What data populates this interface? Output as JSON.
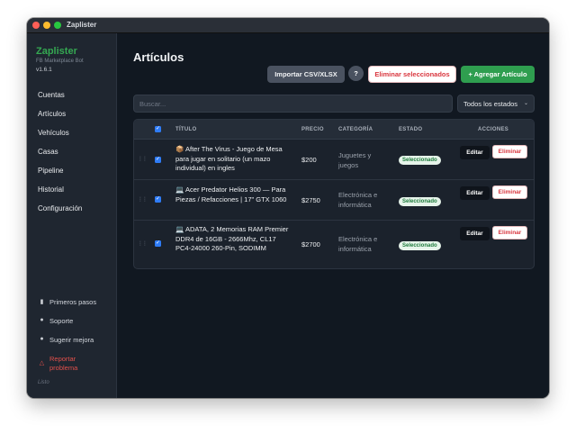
{
  "window": {
    "title": "Zaplister"
  },
  "sidebar": {
    "brand": {
      "name": "Zaplister",
      "subtitle": "FB Marketplace Bot",
      "version": "v1.6.1"
    },
    "nav": [
      "Cuentas",
      "Artículos",
      "Vehículos",
      "Casas",
      "Pipeline",
      "Historial",
      "Configuración"
    ],
    "bottom": [
      {
        "label": "Primeros pasos",
        "icon": "book-icon"
      },
      {
        "label": "Soporte",
        "icon": "chat-bubble-icon"
      },
      {
        "label": "Sugerir mejora",
        "icon": "lightbulb-icon"
      },
      {
        "label": "Reportar problema",
        "icon": "warning-triangle-icon"
      }
    ],
    "status": "Listo"
  },
  "main": {
    "title": "Artículos",
    "buttons": {
      "import": "Importar CSV/XLSX",
      "help": "?",
      "delete_selected": "Eliminar seleccionados",
      "add": "+ Agregar Artículo"
    },
    "search": {
      "placeholder": "Buscar...",
      "value": ""
    },
    "filter": {
      "selected": "Todos los estados"
    },
    "table": {
      "headers": [
        "TÍTULO",
        "PRECIO",
        "CATEGORÍA",
        "ESTADO",
        "ACCIONES"
      ],
      "rows": [
        {
          "icon": "📦",
          "title": "After The Virus - Juego de Mesa para jugar en solitario (un mazo individual) en ingles",
          "price": "$200",
          "category": "Juguetes y juegos",
          "status": "Seleccionado",
          "edit": "Editar",
          "delete": "Eliminar",
          "checked": true
        },
        {
          "icon": "💻",
          "title": "Acer Predator Helios 300 — Para Piezas / Refacciones | 17\" GTX 1060",
          "price": "$2750",
          "category": "Electrónica e informática",
          "status": "Seleccionado",
          "edit": "Editar",
          "delete": "Eliminar",
          "checked": true
        },
        {
          "icon": "💻",
          "title": "ADATA, 2 Memorias RAM Premier DDR4 de 16GB - 2666Mhz, CL17 PC4-24000 260-Pin, SODIMM",
          "price": "$2700",
          "category": "Electrónica e informática",
          "status": "Seleccionado",
          "edit": "Editar",
          "delete": "Eliminar",
          "checked": true
        }
      ]
    }
  },
  "colors": {
    "brand": "#35a852",
    "add_button": "#2f9e4f",
    "danger": "#d9363e",
    "checkbox": "#2f7cf6",
    "badge_bg": "#e6f4ea",
    "badge_text": "#1e7b3c"
  }
}
